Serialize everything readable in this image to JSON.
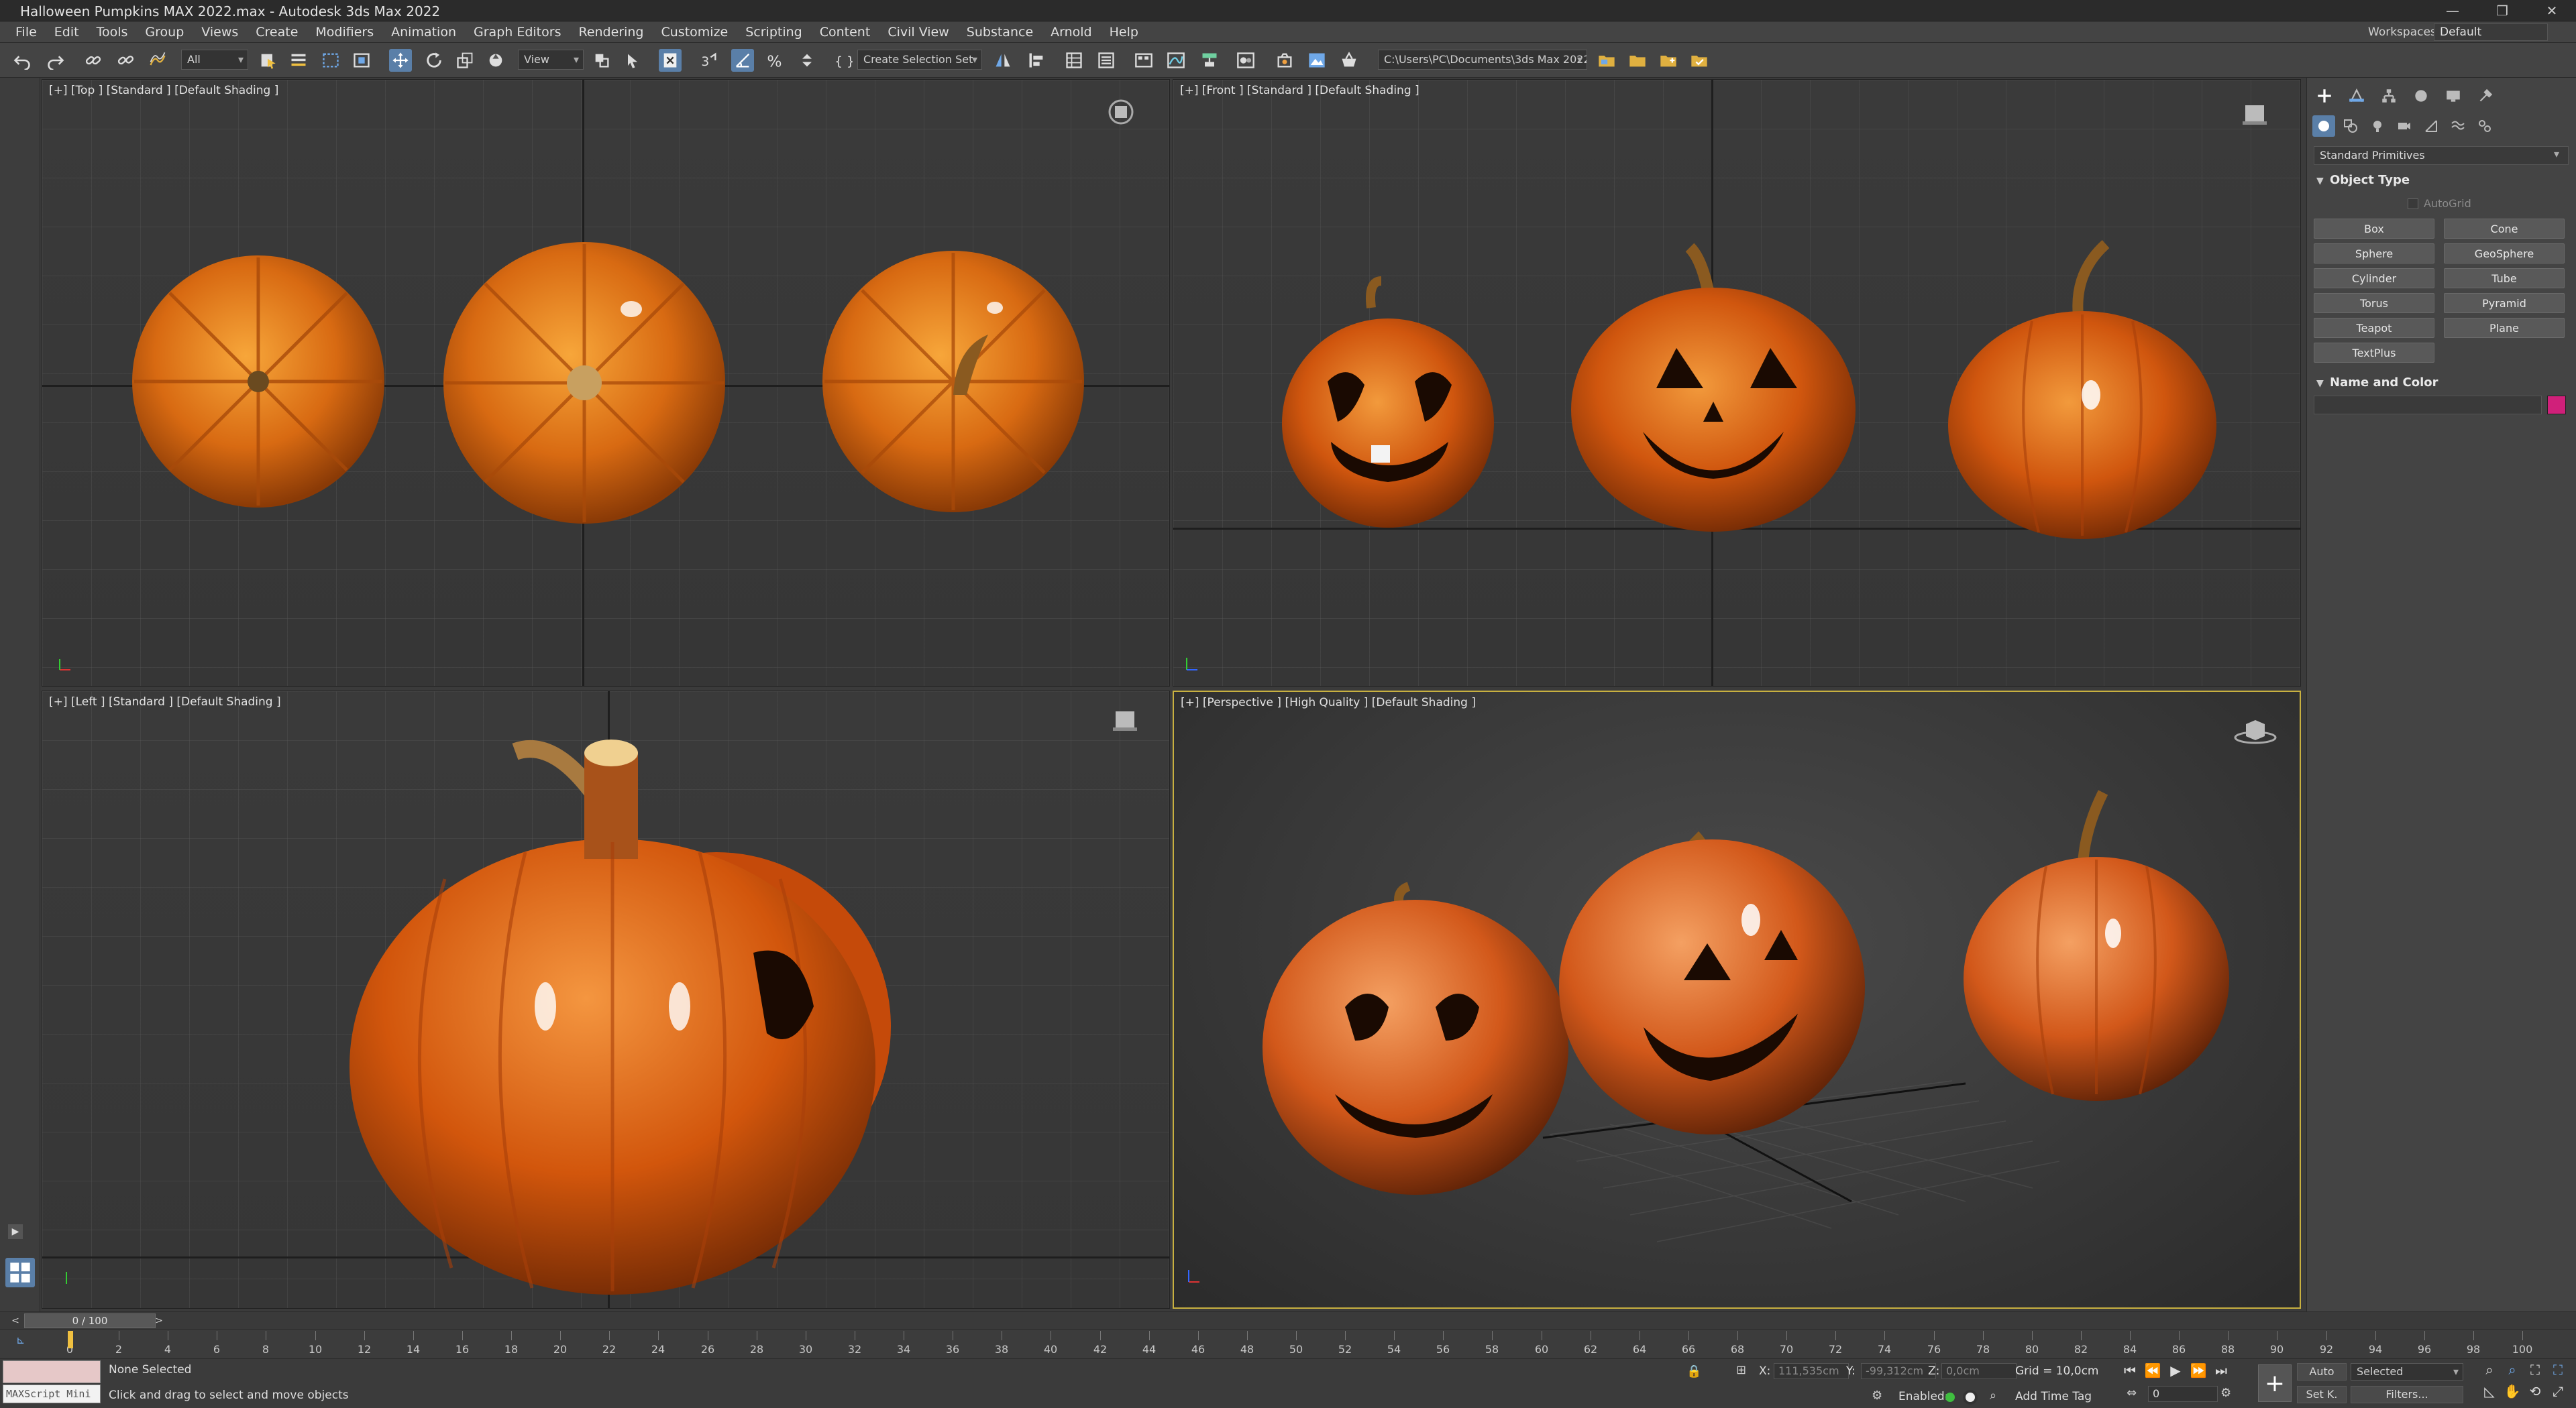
{
  "window": {
    "title": "Halloween Pumpkins MAX 2022.max - Autodesk 3ds Max 2022"
  },
  "menu": [
    "File",
    "Edit",
    "Tools",
    "Group",
    "Views",
    "Create",
    "Modifiers",
    "Animation",
    "Graph Editors",
    "Rendering",
    "Customize",
    "Scripting",
    "Content",
    "Civil View",
    "Substance",
    "Arnold",
    "Help"
  ],
  "workspaces": {
    "label": "Workspaces:",
    "value": "Default"
  },
  "toolbar": {
    "selection_filter": "All",
    "ref_coord": "View",
    "named_selection": "Create Selection Set",
    "project_path": "C:\\Users\\PC\\Documents\\3ds Max 2022"
  },
  "viewports": {
    "top": {
      "label": "[+] [Top ] [Standard ] [Default Shading ]"
    },
    "front": {
      "label": "[+] [Front ] [Standard ] [Default Shading ]"
    },
    "left": {
      "label": "[+] [Left ] [Standard ] [Default Shading ]"
    },
    "perspective": {
      "label": "[+] [Perspective ] [High Quality ] [Default Shading ]"
    }
  },
  "command_panel": {
    "category": "Standard Primitives",
    "object_type_title": "Object Type",
    "autogrid": "AutoGrid",
    "primitives": [
      "Box",
      "Cone",
      "Sphere",
      "GeoSphere",
      "Cylinder",
      "Tube",
      "Torus",
      "Pyramid",
      "Teapot",
      "Plane",
      "TextPlus"
    ],
    "name_color_title": "Name and Color",
    "object_color": "#d0207a"
  },
  "time": {
    "frame_display": "0 / 100",
    "ticks": [
      "0",
      "2",
      "4",
      "6",
      "8",
      "10",
      "12",
      "14",
      "16",
      "18",
      "20",
      "22",
      "24",
      "26",
      "28",
      "30",
      "32",
      "34",
      "36",
      "38",
      "40",
      "42",
      "44",
      "46",
      "48",
      "50",
      "52",
      "54",
      "56",
      "58",
      "60",
      "62",
      "64",
      "66",
      "68",
      "70",
      "72",
      "74",
      "76",
      "78",
      "80",
      "82",
      "84",
      "86",
      "88",
      "90",
      "92",
      "94",
      "96",
      "98",
      "100"
    ]
  },
  "status": {
    "maxscript": "MAXScript Mini",
    "selection": "None Selected",
    "prompt": "Click and drag to select and move objects",
    "x_label": "X:",
    "x_value": "111,535cm",
    "y_label": "Y:",
    "y_value": "-99,312cm",
    "z_label": "Z:",
    "z_value": "0,0cm",
    "grid": "Grid = 10,0cm",
    "enabled": "Enabled:",
    "add_time_tag": "Add Time Tag",
    "auto": "Auto",
    "setk": "Set K.",
    "key_filter": "Selected",
    "filters": "Filters...",
    "current_frame": "0"
  }
}
